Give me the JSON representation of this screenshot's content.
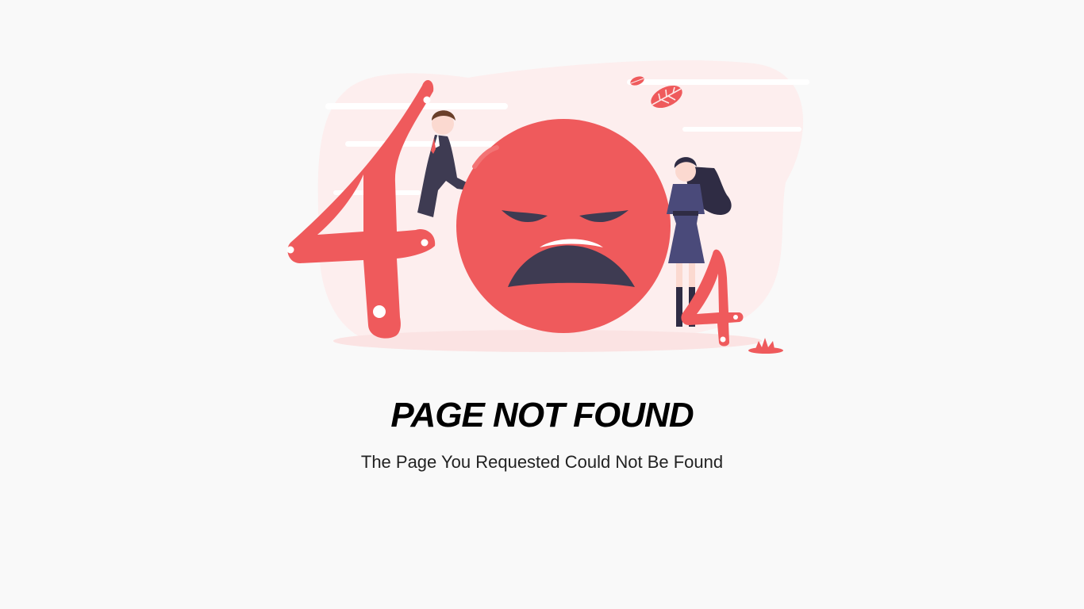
{
  "error": {
    "title": "PAGE NOT FOUND",
    "message": "The Page You Requested Could Not Be Found"
  },
  "illustration": {
    "icon": "sad-face-404-illustration",
    "digits": [
      "4",
      "4"
    ]
  },
  "colors": {
    "background": "#f9f9f9",
    "accent": "#ef5a5c",
    "accent_light": "#fde9e9",
    "dark": "#3e3b52",
    "title_text": "#000000",
    "body_text": "#222222"
  }
}
